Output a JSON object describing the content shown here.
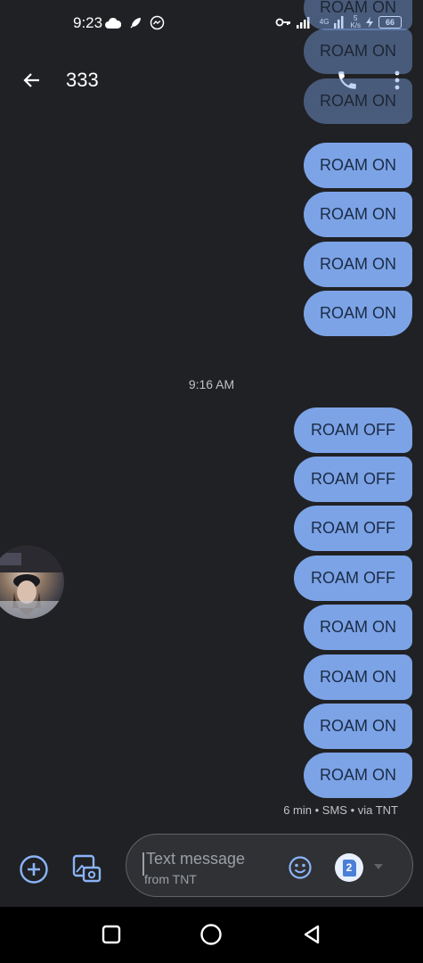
{
  "status_bar": {
    "time": "9:23",
    "network": "4G",
    "speed_value": "5",
    "speed_unit": "K/s",
    "battery": "66"
  },
  "app_bar": {
    "title": "333"
  },
  "messages": [
    {
      "text": "ROAM ON",
      "faded": true
    },
    {
      "text": "ROAM ON",
      "faded": true
    },
    {
      "text": "ROAM ON",
      "faded": true
    },
    {
      "text": "ROAM ON"
    },
    {
      "text": "ROAM ON"
    },
    {
      "text": "ROAM ON"
    },
    {
      "text": "ROAM ON"
    },
    {
      "text": "ROAM OFF"
    },
    {
      "text": "ROAM OFF"
    },
    {
      "text": "ROAM OFF"
    },
    {
      "text": "ROAM OFF"
    },
    {
      "text": "ROAM ON"
    },
    {
      "text": "ROAM ON"
    },
    {
      "text": "ROAM ON"
    },
    {
      "text": "ROAM ON"
    }
  ],
  "timestamp_divider": "9:16 AM",
  "message_meta": "6 min • SMS • via TNT",
  "composer": {
    "placeholder": "Text message",
    "sim_label": "from TNT",
    "sim_number": "2"
  },
  "colors": {
    "background": "#202124",
    "bubble": "#7ca3e6",
    "accent_icon": "#8ab4f8"
  },
  "icons": {
    "back": "arrow-back-icon",
    "call": "phone-icon",
    "more": "more-vert-icon",
    "add": "add-circle-icon",
    "gallery": "gallery-camera-icon",
    "emoji": "emoji-icon",
    "sim": "sim-card-icon"
  }
}
